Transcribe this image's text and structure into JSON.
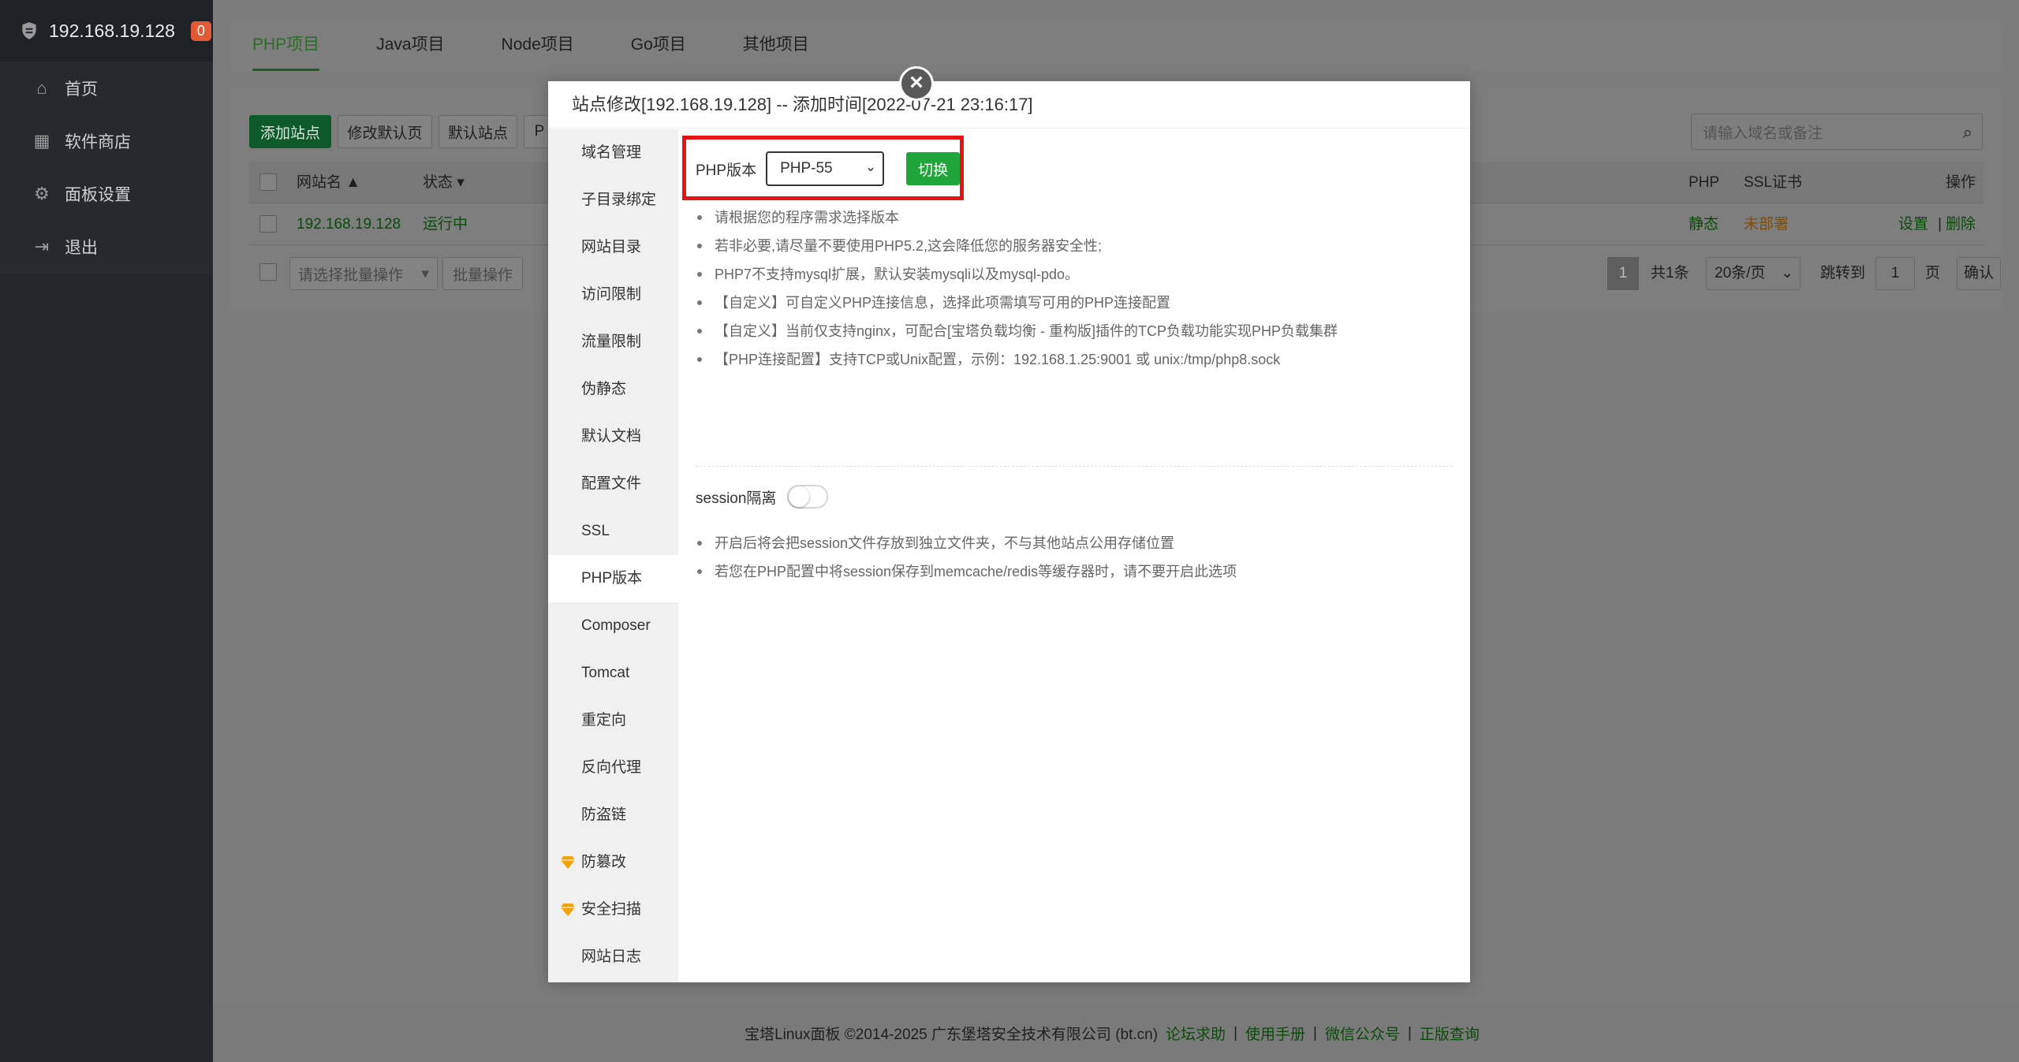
{
  "sidebar": {
    "host": "192.168.19.128",
    "badge": "0",
    "items": [
      {
        "label": "首页",
        "icon": "home-icon"
      },
      {
        "label": "软件商店",
        "icon": "grid-icon"
      },
      {
        "label": "面板设置",
        "icon": "gear-icon"
      },
      {
        "label": "退出",
        "icon": "logout-icon"
      }
    ]
  },
  "tabs": [
    "PHP项目",
    "Java项目",
    "Node项目",
    "Go项目",
    "其他项目"
  ],
  "toolbar": {
    "add_site": "添加站点",
    "edit_default_page": "修改默认页",
    "default_site": "默认站点",
    "truncated": "P",
    "search_placeholder": "请输入域名或备注"
  },
  "table": {
    "headers": {
      "name": "网站名 ▲",
      "status": "状态 ▾",
      "php": "PHP",
      "ssl": "SSL证书",
      "ops": "操作"
    },
    "rows": [
      {
        "name": "192.168.19.128",
        "status": "运行中",
        "php": "静态",
        "ssl": "未部署",
        "set": "设置",
        "del": "删除"
      }
    ]
  },
  "batch": {
    "placeholder": "请选择批量操作",
    "button": "批量操作"
  },
  "pagination": {
    "current": "1",
    "total": "共1条",
    "per_page": "20条/页",
    "jump_label": "跳转到",
    "jump_value": "1",
    "page_unit": "页",
    "confirm": "确认"
  },
  "footer": {
    "copyright": "宝塔Linux面板 ©2014-2025 广东堡塔安全技术有限公司 (bt.cn)",
    "links": [
      "论坛求助",
      "使用手册",
      "微信公众号",
      "正版查询"
    ]
  },
  "modal": {
    "title": "站点修改[192.168.19.128] -- 添加时间[2022-07-21 23:16:17]",
    "close": "×",
    "nav": [
      {
        "label": "域名管理",
        "gem": false
      },
      {
        "label": "子目录绑定",
        "gem": false
      },
      {
        "label": "网站目录",
        "gem": false
      },
      {
        "label": "访问限制",
        "gem": false
      },
      {
        "label": "流量限制",
        "gem": false
      },
      {
        "label": "伪静态",
        "gem": false
      },
      {
        "label": "默认文档",
        "gem": false
      },
      {
        "label": "配置文件",
        "gem": false
      },
      {
        "label": "SSL",
        "gem": false
      },
      {
        "label": "PHP版本",
        "gem": false,
        "active": true
      },
      {
        "label": "Composer",
        "gem": false
      },
      {
        "label": "Tomcat",
        "gem": false
      },
      {
        "label": "重定向",
        "gem": false
      },
      {
        "label": "反向代理",
        "gem": false
      },
      {
        "label": "防盗链",
        "gem": false
      },
      {
        "label": "防篡改",
        "gem": true
      },
      {
        "label": "安全扫描",
        "gem": true
      },
      {
        "label": "网站日志",
        "gem": false
      }
    ],
    "php_label": "PHP版本",
    "php_selected": "PHP-55",
    "switch_label": "切换",
    "tips": [
      "请根据您的程序需求选择版本",
      "若非必要,请尽量不要使用PHP5.2,这会降低您的服务器安全性;",
      "PHP7不支持mysql扩展，默认安装mysqli以及mysql-pdo。",
      "【自定义】可自定义PHP连接信息，选择此项需填写可用的PHP连接配置",
      "【自定义】当前仅支持nginx，可配合[宝塔负载均衡 - 重构版]插件的TCP负载功能实现PHP负载集群",
      "【PHP连接配置】支持TCP或Unix配置，示例：192.168.1.25:9001 或 unix:/tmp/php8.sock"
    ],
    "session_label": "session隔离",
    "session_enabled": false,
    "session_tips": [
      "开启后将会把session文件存放到独立文件夹，不与其他站点公用存储位置",
      "若您在PHP配置中将session保存到memcache/redis等缓存器时，请不要开启此选项"
    ],
    "colors": {
      "accent": "#20a53a",
      "highlight_box": "#e51414",
      "gem": "#f0a30a"
    }
  }
}
